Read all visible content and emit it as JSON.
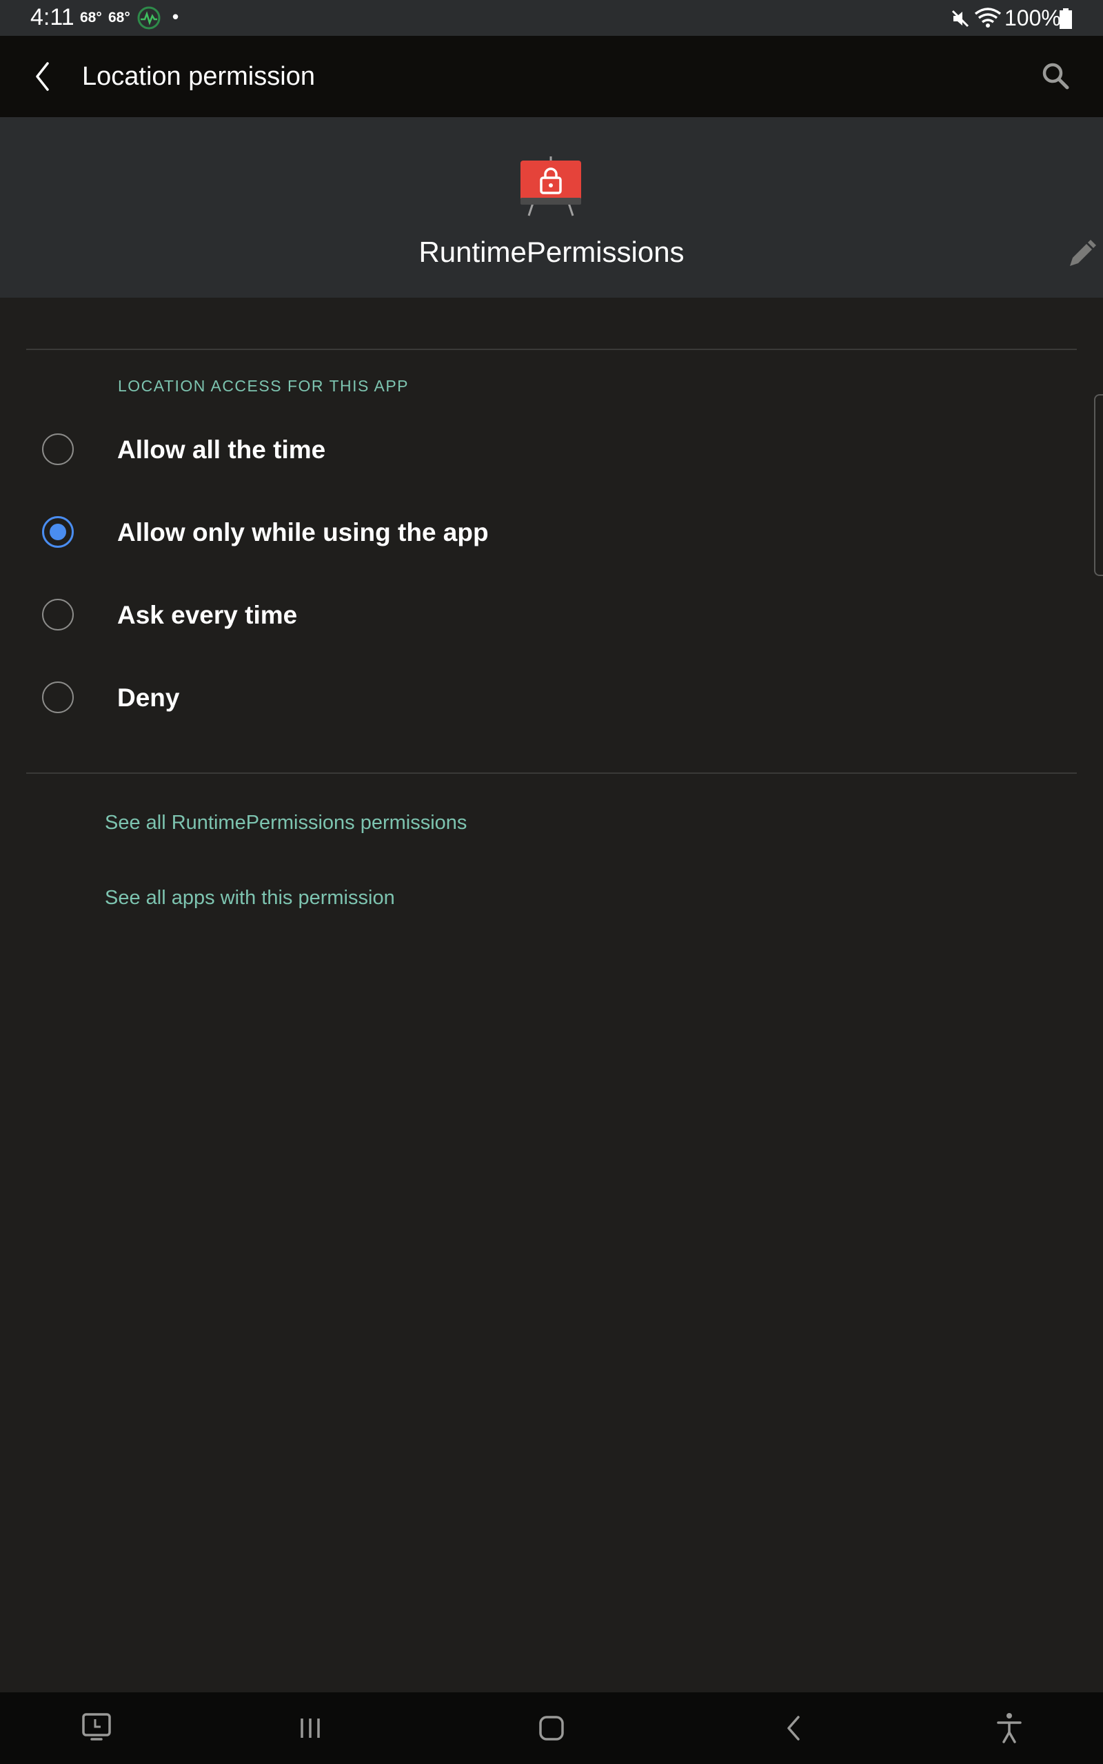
{
  "status_bar": {
    "time": "4:11",
    "temp1": "68°",
    "temp2": "68°",
    "dot": "•",
    "battery": "100%"
  },
  "app_bar": {
    "title": "Location permission"
  },
  "header": {
    "app_name": "RuntimePermissions"
  },
  "section": {
    "title": "LOCATION ACCESS FOR THIS APP"
  },
  "options": [
    {
      "label": "Allow all the time",
      "selected": false
    },
    {
      "label": "Allow only while using the app",
      "selected": true
    },
    {
      "label": "Ask every time",
      "selected": false
    },
    {
      "label": "Deny",
      "selected": false
    }
  ],
  "links": {
    "app_permissions": "See all RuntimePermissions permissions",
    "apps_with_permission": "See all apps with this permission"
  },
  "colors": {
    "accent": "#7dc4b0",
    "radio_selected": "#4a8df0",
    "app_icon": "#e5433a"
  },
  "icons": {
    "status": [
      "weather-icon",
      "mute-icon",
      "wifi-icon",
      "battery-icon"
    ],
    "navigation": [
      "screen-icon",
      "recents-icon",
      "home-icon",
      "back-icon",
      "accessibility-icon"
    ]
  }
}
